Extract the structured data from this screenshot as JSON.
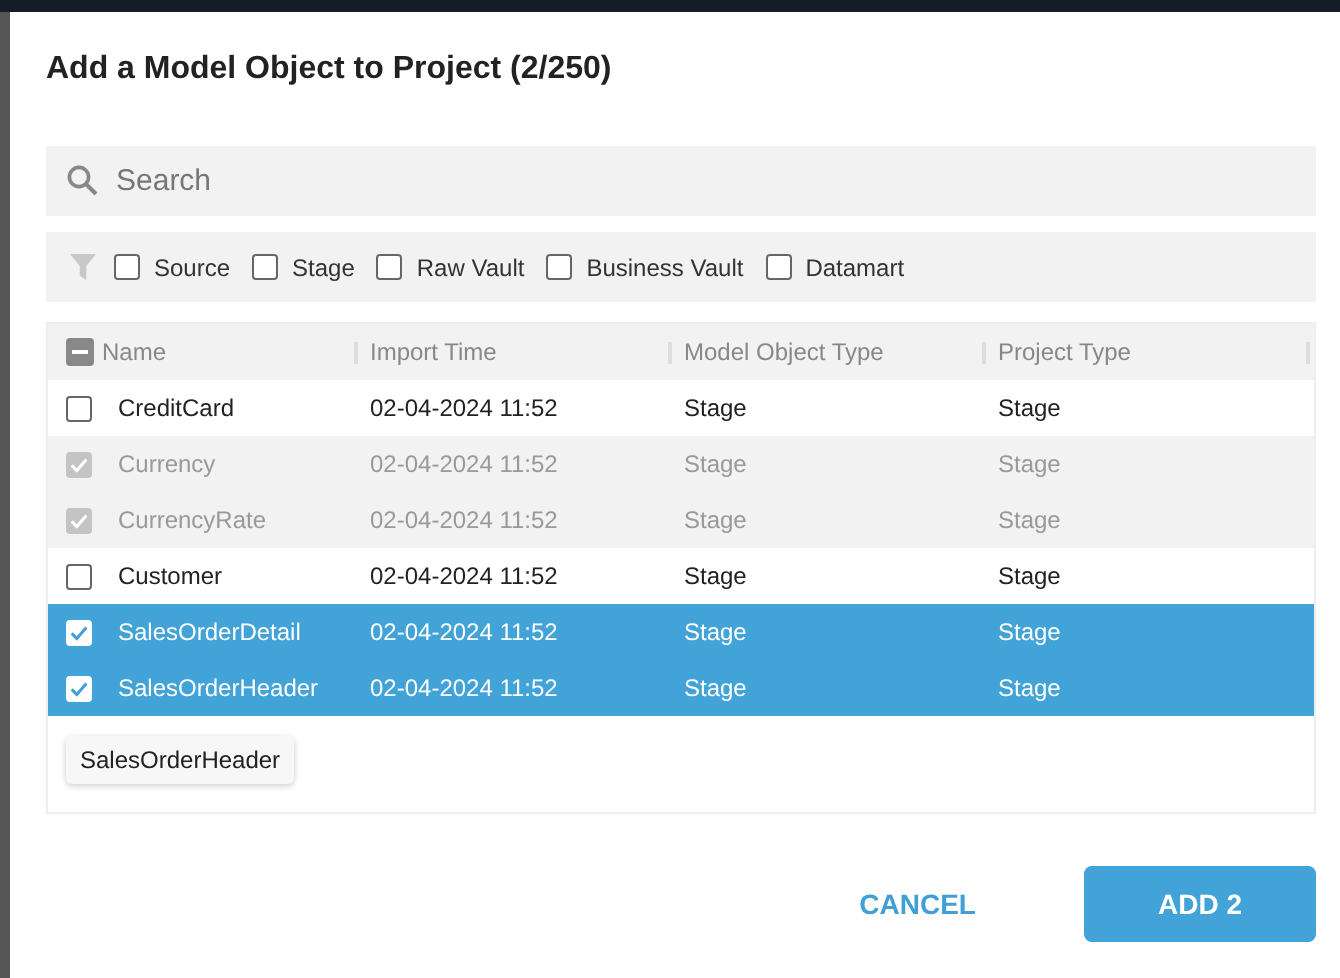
{
  "dialog": {
    "title": "Add a Model Object to Project (2/250)"
  },
  "search": {
    "placeholder": "Search"
  },
  "filters": [
    {
      "label": "Source",
      "checked": false
    },
    {
      "label": "Stage",
      "checked": false
    },
    {
      "label": "Raw Vault",
      "checked": false
    },
    {
      "label": "Business Vault",
      "checked": false
    },
    {
      "label": "Datamart",
      "checked": false
    }
  ],
  "table": {
    "select_all": {
      "indeterminate": true
    },
    "columns": [
      "Name",
      "Import Time",
      "Model Object Type",
      "Project Type"
    ],
    "rows": [
      {
        "cells": [
          "CreditCard",
          "02-04-2024 11:52",
          "Stage",
          "Stage"
        ],
        "checked": false,
        "disabled": false,
        "selected": false
      },
      {
        "cells": [
          "Currency",
          "02-04-2024 11:52",
          "Stage",
          "Stage"
        ],
        "checked": true,
        "disabled": true,
        "selected": false
      },
      {
        "cells": [
          "CurrencyRate",
          "02-04-2024 11:52",
          "Stage",
          "Stage"
        ],
        "checked": true,
        "disabled": true,
        "selected": false
      },
      {
        "cells": [
          "Customer",
          "02-04-2024 11:52",
          "Stage",
          "Stage"
        ],
        "checked": false,
        "disabled": false,
        "selected": false
      },
      {
        "cells": [
          "SalesOrderDetail",
          "02-04-2024 11:52",
          "Stage",
          "Stage"
        ],
        "checked": true,
        "disabled": false,
        "selected": true
      },
      {
        "cells": [
          "SalesOrderHeader",
          "02-04-2024 11:52",
          "Stage",
          "Stage"
        ],
        "checked": true,
        "disabled": false,
        "selected": true
      }
    ]
  },
  "tooltip": "SalesOrderHeader",
  "buttons": [
    {
      "label": "CANCEL",
      "kind": "text"
    },
    {
      "label": "ADD 2",
      "kind": "primary"
    }
  ]
}
